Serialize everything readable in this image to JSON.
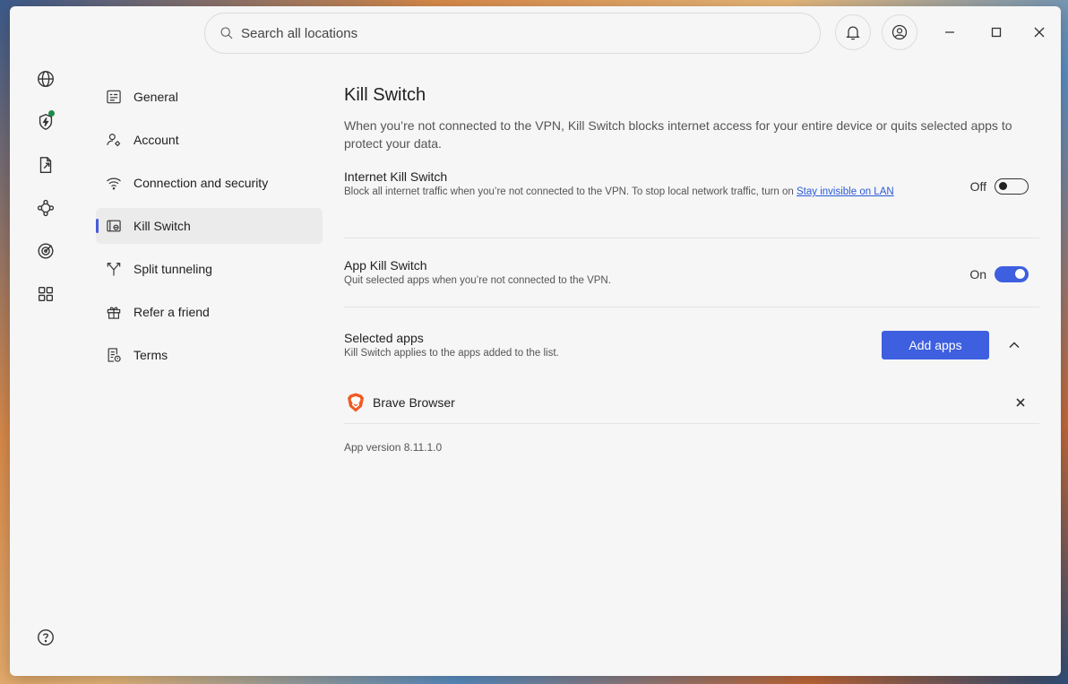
{
  "search": {
    "placeholder": "Search all locations"
  },
  "nav": {
    "items": [
      {
        "label": "General",
        "icon": "list-icon"
      },
      {
        "label": "Account",
        "icon": "user-gear-icon"
      },
      {
        "label": "Connection and security",
        "icon": "wifi-icon"
      },
      {
        "label": "Kill Switch",
        "icon": "kill-switch-icon",
        "active": true
      },
      {
        "label": "Split tunneling",
        "icon": "split-icon"
      },
      {
        "label": "Refer a friend",
        "icon": "gift-icon"
      },
      {
        "label": "Terms",
        "icon": "document-icon"
      }
    ]
  },
  "page": {
    "title": "Kill Switch",
    "description": "When you’re not connected to the VPN, Kill Switch blocks internet access for your entire device or quits selected apps to protect your data."
  },
  "internet_kill_switch": {
    "title": "Internet Kill Switch",
    "subtitle": "Block all internet traffic when you’re not connected to the VPN. To stop local network traffic, turn on",
    "link": "Stay invisible on LAN",
    "state_label": "Off",
    "enabled": false
  },
  "app_kill_switch": {
    "title": "App Kill Switch",
    "subtitle": "Quit selected apps when you’re not connected to the VPN.",
    "state_label": "On",
    "enabled": true
  },
  "selected_apps": {
    "title": "Selected apps",
    "subtitle": "Kill Switch applies to the apps added to the list.",
    "add_label": "Add apps",
    "apps": [
      {
        "name": "Brave Browser",
        "icon": "brave-lion-icon"
      }
    ]
  },
  "version": "App version 8.11.1.0",
  "colors": {
    "accent": "#3d5fe0",
    "link": "#2c5ad8",
    "active_indicator": "#4a5bd8",
    "status_dot": "#1e8a4a"
  }
}
